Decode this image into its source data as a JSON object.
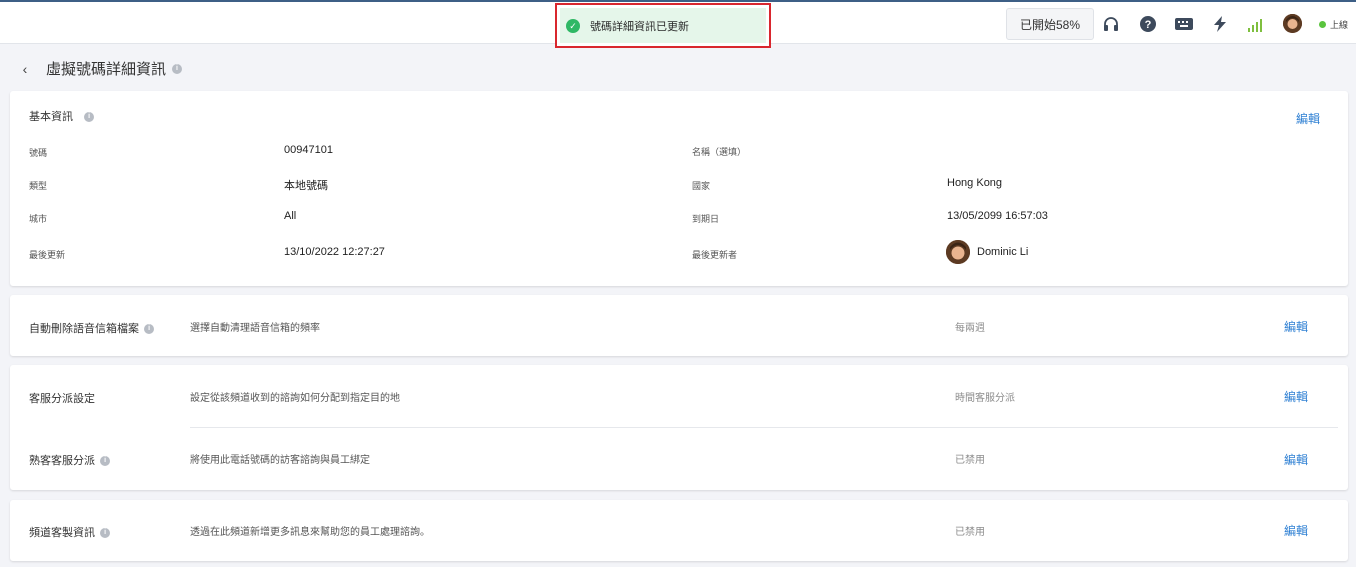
{
  "toast": {
    "message": "號碼詳細資訊已更新"
  },
  "topbar": {
    "progress_label": "已開始58%",
    "status_text": "上線",
    "icons": [
      "headset-icon",
      "help-icon",
      "keyboard-icon",
      "bolt-icon",
      "signal-icon",
      "avatar"
    ]
  },
  "page": {
    "title": "虛擬號碼詳細資訊"
  },
  "basic_info": {
    "title": "基本資訊",
    "edit_label": "編輯",
    "fields": {
      "number_label": "號碼",
      "number_value": "00947101",
      "type_label": "類型",
      "type_value": "本地號碼",
      "city_label": "城市",
      "city_value": "All",
      "updated_label": "最後更新",
      "updated_value": "13/10/2022 12:27:27",
      "name_label": "名稱（選填）",
      "country_label": "國家",
      "country_value": "Hong Kong",
      "expiry_label": "到期日",
      "expiry_value": "13/05/2099 16:57:03",
      "updater_label": "最後更新者",
      "updater_value": "Dominic Li"
    }
  },
  "voicemail": {
    "label": "自動刪除語音信箱檔案",
    "desc": "選擇自動清理語音信箱的頻率",
    "value": "每兩週",
    "edit_label": "編輯"
  },
  "routing": {
    "label": "客服分派設定",
    "desc": "設定從該頻道收到的諮詢如何分配到指定目的地",
    "value": "時間客服分派",
    "edit_label": "編輯"
  },
  "sticky": {
    "label": "熟客客服分派",
    "desc": "將使用此電話號碼的訪客諮詢與員工綁定",
    "value": "已禁用",
    "edit_label": "編輯"
  },
  "custom_info": {
    "label": "頻道客製資訊",
    "desc": "透過在此頻道新增更多訊息來幫助您的員工處理諮詢。",
    "value": "已禁用",
    "edit_label": "編輯"
  },
  "colors": {
    "accent": "#2d7fd3",
    "success": "#2fb865",
    "online": "#5ac43e",
    "toast_border": "#d9272e"
  }
}
